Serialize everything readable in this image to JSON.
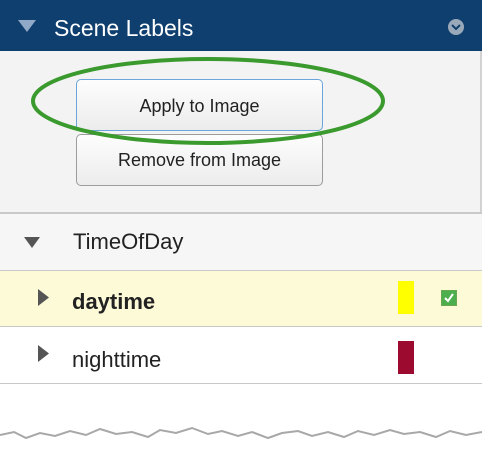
{
  "panel": {
    "title": "Scene Labels",
    "header_color": "#0f3f6f",
    "icons": {
      "collapse": "triangle-down-icon",
      "options": "chevron-circle-icon"
    }
  },
  "buttons": {
    "apply_label": "Apply to Image",
    "remove_label": "Remove from Image",
    "highlight_color": "#3a9a2e"
  },
  "label_group": {
    "name": "TimeOfDay",
    "expanded": true,
    "items": [
      {
        "label": "daytime",
        "color": "#ffff00",
        "selected": true,
        "checked": true
      },
      {
        "label": "nighttime",
        "color": "#9c0a30",
        "selected": false,
        "checked": false
      }
    ]
  }
}
